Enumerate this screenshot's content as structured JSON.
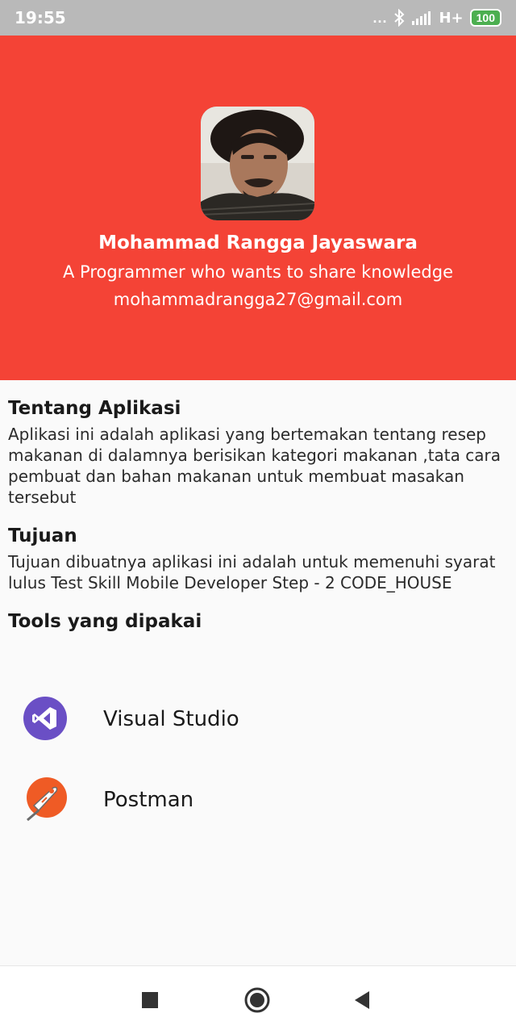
{
  "status_bar": {
    "time": "19:55",
    "dots": "...",
    "network": "H+",
    "battery": "100"
  },
  "profile": {
    "name": "Mohammad Rangga Jayaswara",
    "tagline": "A Programmer who wants to share knowledge",
    "email": "mohammadrangga27@gmail.com"
  },
  "sections": {
    "about_title": "Tentang Aplikasi",
    "about_body": "Aplikasi ini adalah aplikasi yang bertemakan tentang resep makanan di dalamnya berisikan kategori makanan ,tata cara pembuat dan bahan makanan untuk membuat masakan tersebut",
    "goal_title": "Tujuan",
    "goal_body": "Tujuan dibuatnya aplikasi ini adalah untuk memenuhi syarat lulus Test Skill Mobile Developer Step - 2 CODE_HOUSE",
    "tools_title": "Tools yang dipakai"
  },
  "tools": [
    {
      "label": "Visual Studio",
      "icon": "visual-studio-icon"
    },
    {
      "label": "Postman",
      "icon": "postman-icon"
    }
  ],
  "nav": {
    "icons": [
      "square-recents-icon",
      "circle-home-icon",
      "triangle-back-icon"
    ]
  },
  "colors": {
    "header": "#f44336",
    "status_bar": "#b9b9b9",
    "background": "#fafafa"
  }
}
